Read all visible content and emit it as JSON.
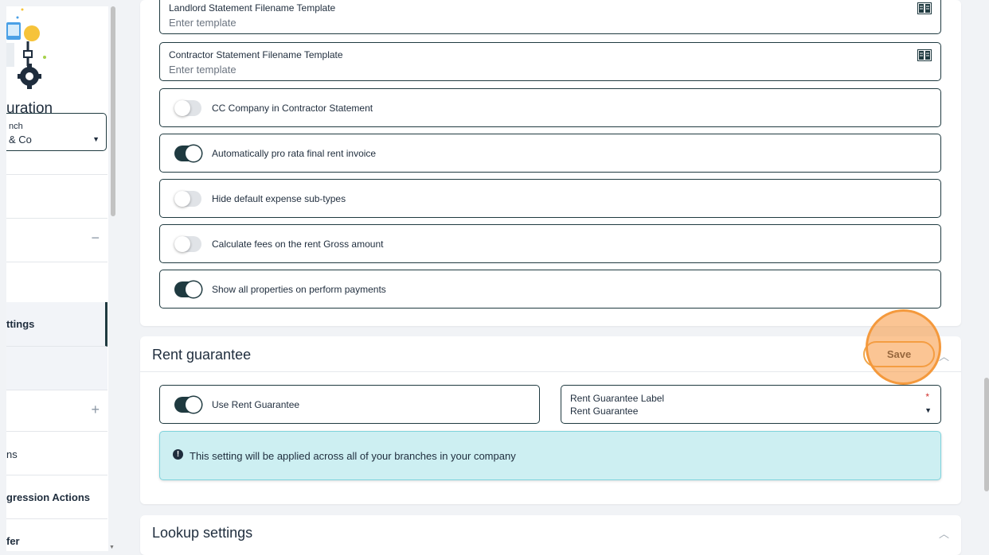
{
  "sidebar": {
    "title_fragment": "uration",
    "branch": {
      "label": "nch",
      "value": "& Co"
    },
    "rows": [
      {
        "label": "",
        "symbol": ""
      },
      {
        "label": "",
        "symbol": ""
      },
      {
        "label": "",
        "symbol": "−"
      },
      {
        "label": "ttings",
        "symbol": ""
      },
      {
        "label": "",
        "symbol": ""
      },
      {
        "label": "",
        "symbol": "+"
      },
      {
        "label": "ns",
        "symbol": ""
      },
      {
        "label": "gression Actions",
        "symbol": ""
      },
      {
        "label": "fer",
        "symbol": ""
      }
    ]
  },
  "main": {
    "fields": [
      {
        "label": "Landlord Statement Filename Template",
        "placeholder": "Enter template"
      },
      {
        "label": "Contractor Statement Filename Template",
        "placeholder": "Enter template"
      }
    ],
    "toggles": [
      {
        "label": "CC Company in Contractor Statement",
        "on": false
      },
      {
        "label": "Automatically pro rata final rent invoice",
        "on": true
      },
      {
        "label": "Hide default expense sub-types",
        "on": false
      },
      {
        "label": "Calculate fees on the rent Gross amount",
        "on": false
      },
      {
        "label": "Show all properties on perform payments",
        "on": true
      }
    ],
    "rent_guarantee": {
      "title": "Rent guarantee",
      "save_label": "Save",
      "toggle_label": "Use Rent Guarantee",
      "toggle_on": true,
      "select_label": "Rent Guarantee Label",
      "select_value": "Rent Guarantee",
      "required_mark": "*",
      "alert_text": "This setting will be applied across all of your branches in your company",
      "alert_icon": "!"
    },
    "lookup": {
      "title": "Lookup settings"
    }
  },
  "colors": {
    "accent": "#1f3a40",
    "highlight": "#f4993c",
    "alert_bg": "#cdeff2"
  }
}
